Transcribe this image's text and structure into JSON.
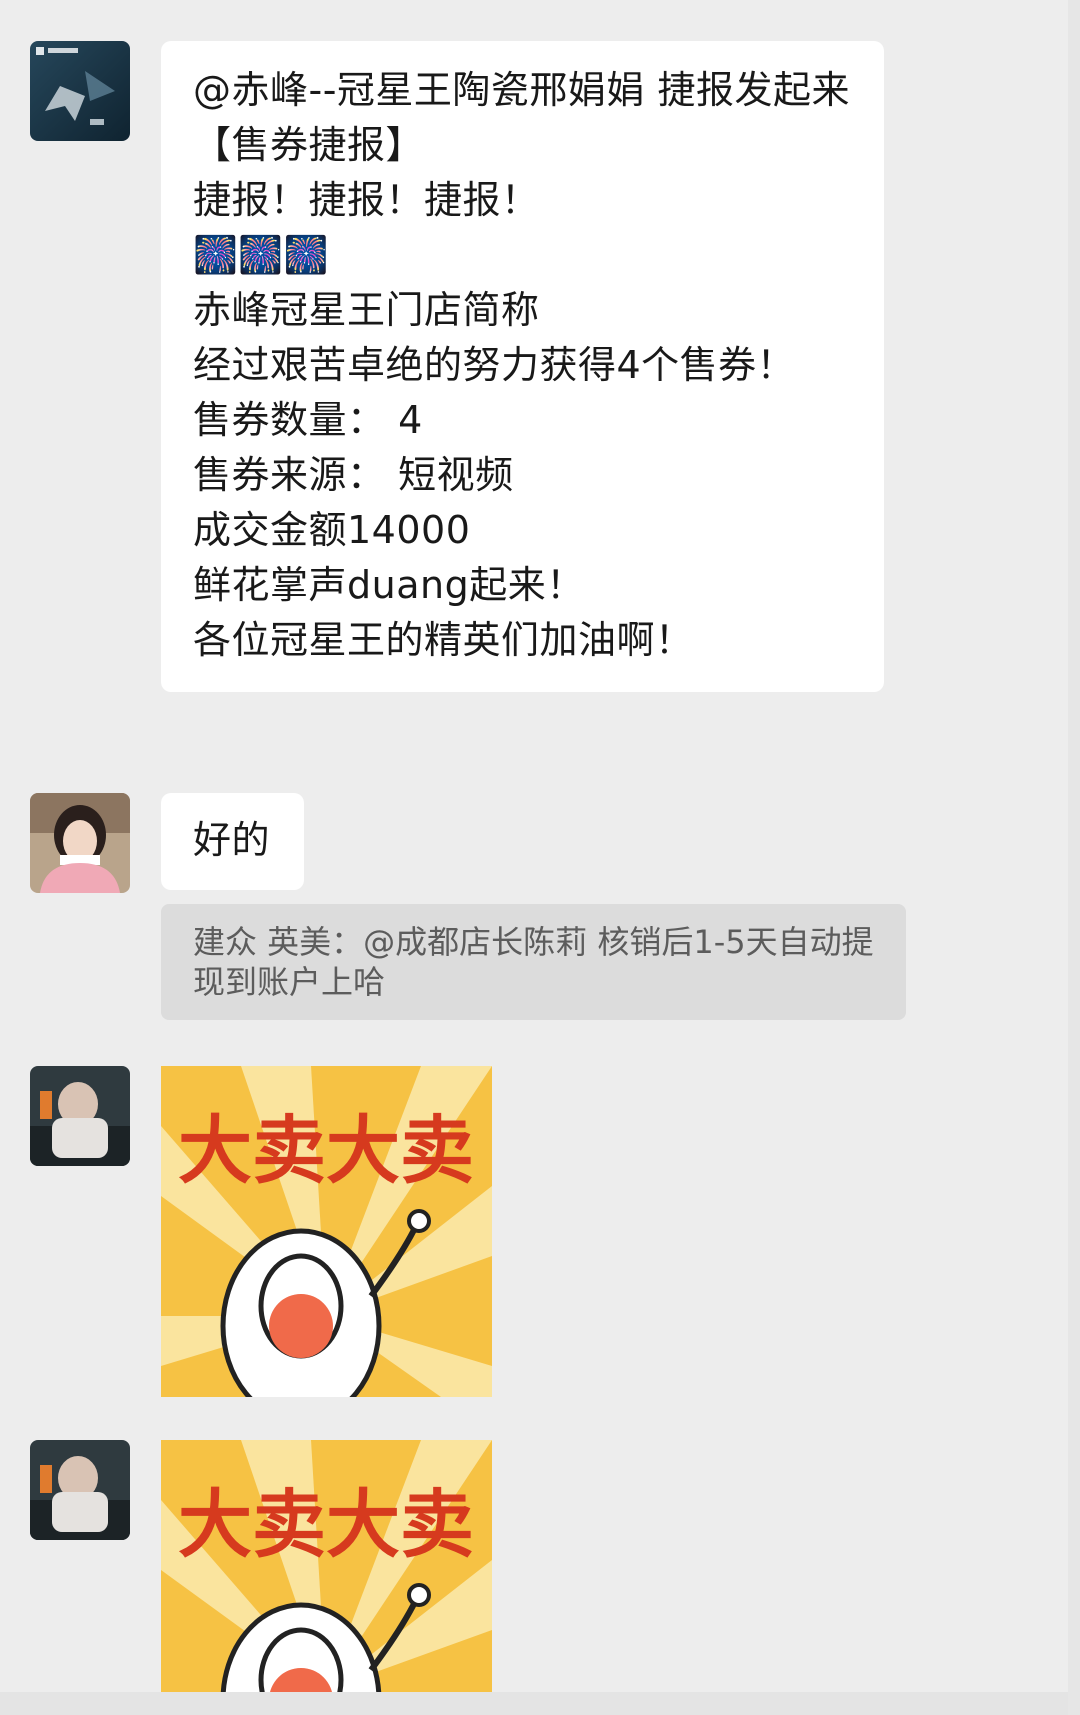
{
  "messages": {
    "report": {
      "lines": [
        "@赤峰--冠星王陶瓷邢娟娟 捷报发起来",
        "【售券捷报】",
        "捷报！捷报！捷报！",
        "🎆🎆🎆",
        "赤峰冠星王门店简称",
        "经过艰苦卓绝的努力获得4个售券！",
        "售券数量： 4",
        "售券来源： 短视频",
        "成交金额14000",
        "鲜花掌声duang起来！",
        "各位冠星王的精英们加油啊！"
      ]
    },
    "reply": {
      "text": "好的",
      "quote": "建众 英美：@成都店长陈莉 核销后1-5天自动提现到账户上哈"
    },
    "sticker_1": {
      "caption": "大卖大卖"
    },
    "sticker_2": {
      "caption": "大卖大卖"
    }
  },
  "colors": {
    "background": "#ededed",
    "bubble": "#ffffff",
    "quote_bg": "#dcdcdc",
    "sticker_bg": "#f6c244",
    "sticker_text": "#d63a1e"
  }
}
